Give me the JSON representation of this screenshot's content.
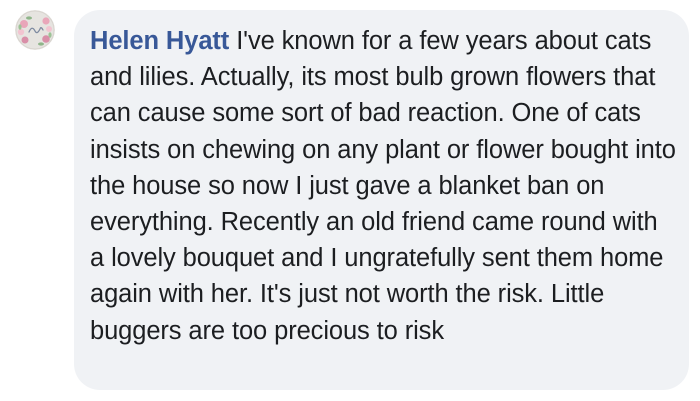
{
  "comment": {
    "author": "Helen Hyatt",
    "text": "I've known for a few years about cats and lilies. Actually, its most bulb grown flowers that can cause some sort of bad reaction. One of cats insists on chewing on any plant or flower bought into the house so now I just gave a blanket ban on everything. Recently an old friend came round with a lovely bouquet and I ungratefully sent them home again with her. It's just not worth the risk. Little buggers are too precious to risk"
  },
  "colors": {
    "author_link": "#385898",
    "bubble_background": "#f0f2f5",
    "text": "#1c1e21"
  }
}
